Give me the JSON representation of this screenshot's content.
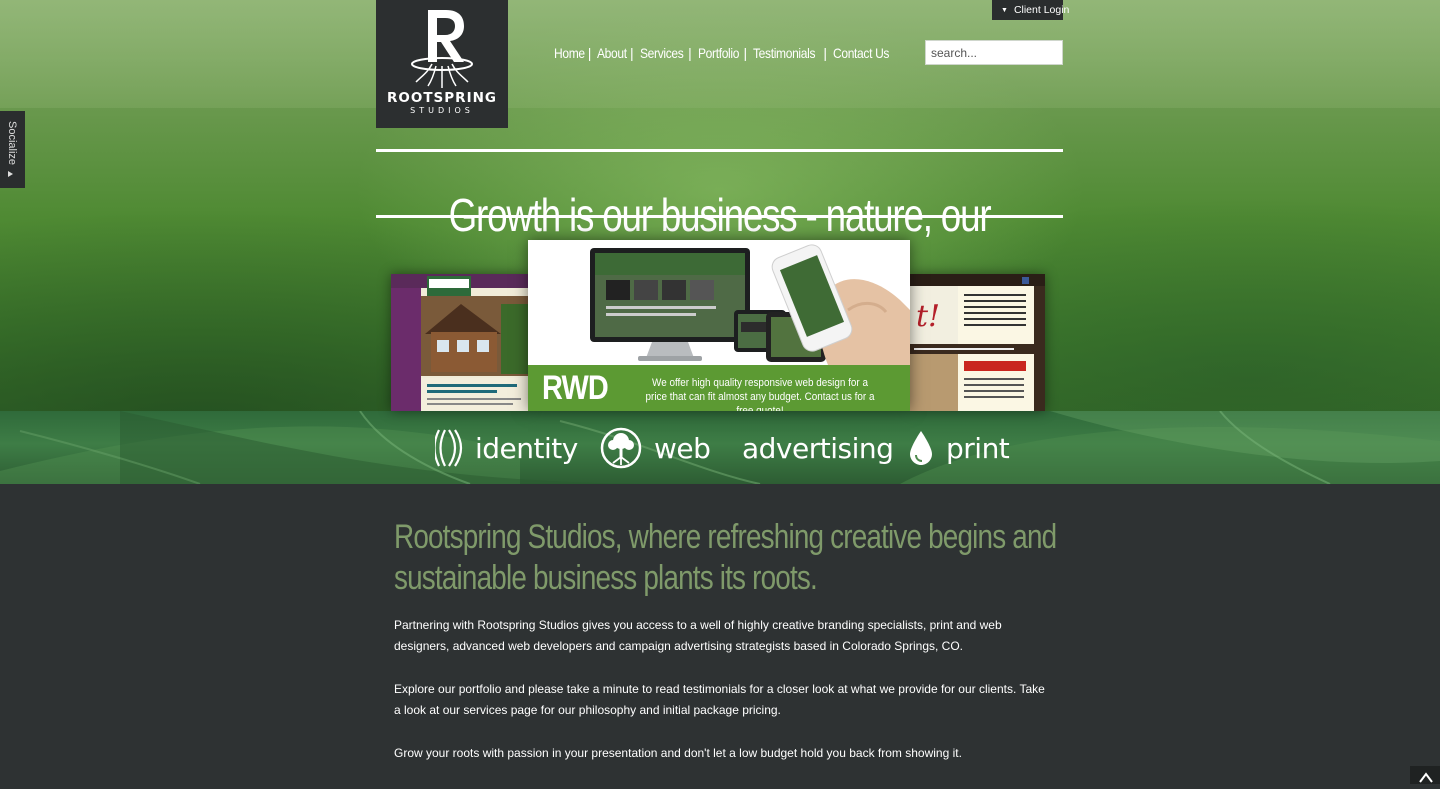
{
  "header": {
    "logo": {
      "letter": "R",
      "name_line1": "ROOTSPRING",
      "name_line2": "STUDIOS"
    },
    "nav": [
      {
        "label": "Home"
      },
      {
        "label": "About"
      },
      {
        "label": "Services"
      },
      {
        "label": "Portfolio"
      },
      {
        "label": "Testimonials"
      },
      {
        "label": "Contact Us"
      }
    ],
    "client_login": "Client Login",
    "search_placeholder": "search..."
  },
  "social_tab": {
    "label": "Socialize"
  },
  "hero": {
    "tagline": "Growth is our business - nature, our model.",
    "slider": {
      "main_badge": "RWD",
      "main_text": "We offer high quality responsive web design for a price that can fit almost any budget. Contact us for a free quote!"
    }
  },
  "services": [
    {
      "label": "identity",
      "icon": "identity-icon"
    },
    {
      "label": "web",
      "icon": "tree-icon"
    },
    {
      "label": "advertising",
      "icon": ""
    },
    {
      "label": "print",
      "icon": "drop-icon"
    }
  ],
  "content": {
    "headline": "Rootspring Studios, where refreshing creative begins and sustainable business plants its roots.",
    "paragraphs": [
      "Partnering with Rootspring Studios gives you access to a well of highly creative branding specialists, print and web designers, advanced web developers and campaign advertising strategists based in Colorado Springs, CO.",
      "Explore our portfolio and please take a minute to read testimonials for a closer look at what we provide for our clients. Take a look at our services page for our philosophy and initial package pricing.",
      "Grow your roots with passion in your presentation and don't let a low budget hold you back from showing it."
    ]
  },
  "colors": {
    "header_dark": "#2c2f30",
    "headline_green": "#7f9a6a",
    "rwd_green": "#5c9a33",
    "body_bg": "#2e3233"
  }
}
